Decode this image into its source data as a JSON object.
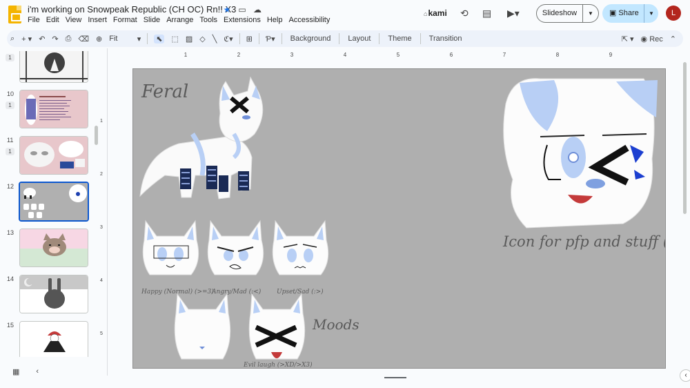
{
  "app": {
    "doc_title": "i'm working on Snowpeak Republic (CH OC) Rn!! X3",
    "menu": [
      "File",
      "Edit",
      "View",
      "Insert",
      "Format",
      "Slide",
      "Arrange",
      "Tools",
      "Extensions",
      "Help",
      "Accessibility"
    ],
    "kami_label": "kami",
    "slideshow_label": "Slideshow",
    "share_label": "Share",
    "avatar_initial": "L"
  },
  "toolbar": {
    "zoom_value": "Fit",
    "background_label": "Background",
    "layout_label": "Layout",
    "theme_label": "Theme",
    "transition_label": "Transition",
    "rec_label": "Rec"
  },
  "filmstrip": {
    "slides": [
      {
        "number": "",
        "badge": "1"
      },
      {
        "number": "10",
        "badge": "1"
      },
      {
        "number": "11",
        "badge": "1"
      },
      {
        "number": "12",
        "badge": ""
      },
      {
        "number": "13",
        "badge": ""
      },
      {
        "number": "14",
        "badge": ""
      },
      {
        "number": "15",
        "badge": ""
      }
    ]
  },
  "ruler": {
    "h_ticks": [
      "1",
      "2",
      "3",
      "4",
      "5",
      "6",
      "7",
      "8",
      "9"
    ],
    "v_ticks": [
      "1",
      "2",
      "3",
      "4",
      "5"
    ]
  },
  "slide": {
    "feral_label": "Feral",
    "icon_caption": "Icon for pfp and stuff (Sona)",
    "moods_label": "Moods",
    "mood_captions": [
      "Happy (Normal) (>=3)",
      "Angry/Mad (:<)",
      "Upset/Sad (:>)",
      "Evil laugh (>XD/>X3)"
    ]
  },
  "colors": {
    "accent": "#0b57d0",
    "share_bg": "#c2e7ff",
    "slide_bg": "#afafaf",
    "fur_blue": "#b8cff5"
  }
}
